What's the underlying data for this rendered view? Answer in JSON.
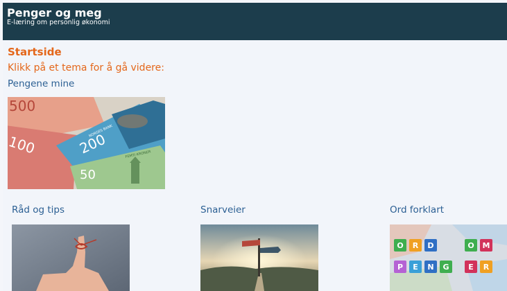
{
  "header": {
    "title": "Penger og meg",
    "subtitle": "E-læring om personlig økonomi"
  },
  "page": {
    "title": "Startside",
    "instruction": "Klikk på et tema for å gå videre:"
  },
  "topics": [
    {
      "label": "Pengene mine",
      "image": "norwegian-banknotes"
    },
    {
      "label": "Råd og tips",
      "image": "finger-with-string"
    },
    {
      "label": "Snarveier",
      "image": "signpost-road"
    },
    {
      "label": "Ord forklart",
      "image": "letter-blocks-on-money"
    }
  ],
  "banknotes": {
    "n500": "500",
    "n200": "200",
    "n100": "100",
    "n50": "50",
    "noregs_bank": "NORGES BANK",
    "femti_kroner": "FEMTI KRONER"
  },
  "letter_blocks": {
    "row1": [
      "O",
      "R",
      "D",
      "",
      "O",
      "M"
    ],
    "row2": [
      "P",
      "E",
      "N",
      "G",
      "E",
      "R"
    ]
  },
  "colors": {
    "header_bg": "#1c3d4c",
    "accent_orange": "#e4671a",
    "link_blue": "#2b5f93",
    "page_bg": "#f2f5fa"
  }
}
